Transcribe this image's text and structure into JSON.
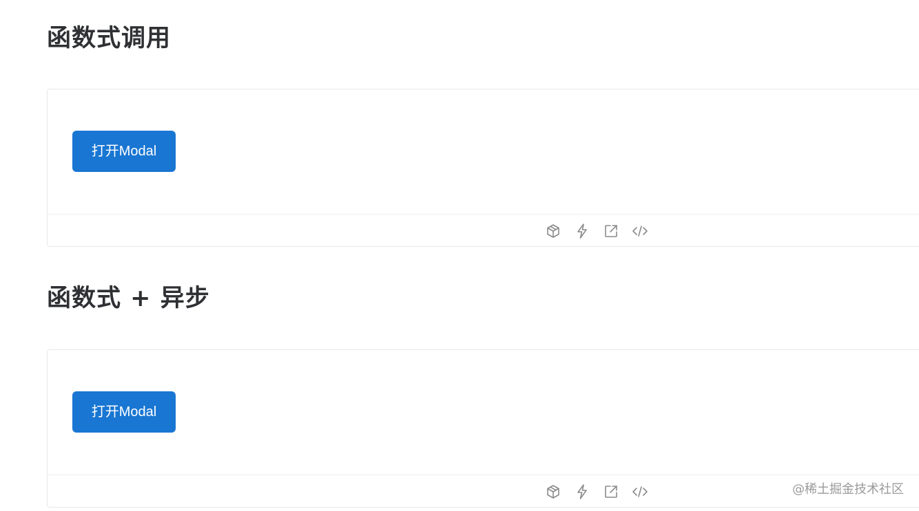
{
  "sections": [
    {
      "title": "函数式调用",
      "button_label": "打开Modal",
      "actions": [
        "cube-icon",
        "lightning-icon",
        "external-link-icon",
        "code-icon"
      ]
    },
    {
      "title": "函数式 + 异步",
      "button_label": "打开Modal",
      "actions": [
        "cube-icon",
        "lightning-icon",
        "external-link-icon",
        "code-icon"
      ]
    }
  ],
  "watermark": "@稀土掘金技术社区",
  "colors": {
    "button_bg": "#1976d2",
    "button_text": "#ffffff",
    "title": "#2f3033",
    "border": "#e8e8e8",
    "icon": "#8a8a8a",
    "watermark": "#9a9a9a"
  }
}
